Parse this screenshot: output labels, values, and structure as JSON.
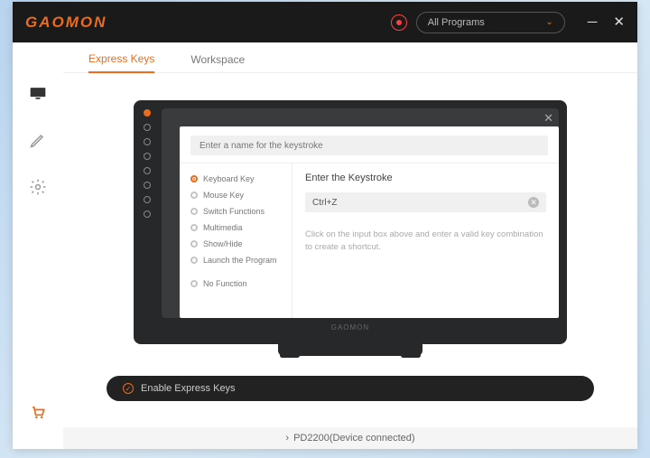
{
  "app": {
    "brand": "GAOMON"
  },
  "header": {
    "dropdown_label": "All Programs"
  },
  "tabs": {
    "express_keys": "Express Keys",
    "workspace": "Workspace"
  },
  "panel": {
    "name_placeholder": "Enter a name for the keystroke",
    "options": {
      "keyboard": "Keyboard Key",
      "mouse": "Mouse Key",
      "switch": "Switch Functions",
      "multimedia": "Multimedia",
      "showhide": "Show/Hide",
      "launch": "Launch the Program",
      "nofn": "No Function"
    },
    "right_title": "Enter the Keystroke",
    "keystroke_value": "Ctrl+Z",
    "hint": "Click on the input box above and  enter a valid key combination to create a shortcut."
  },
  "monitor": {
    "chin_brand": "GAOMON"
  },
  "enable_bar": {
    "label": "Enable Express Keys"
  },
  "footer": {
    "status": "PD2200(Device connected)"
  }
}
